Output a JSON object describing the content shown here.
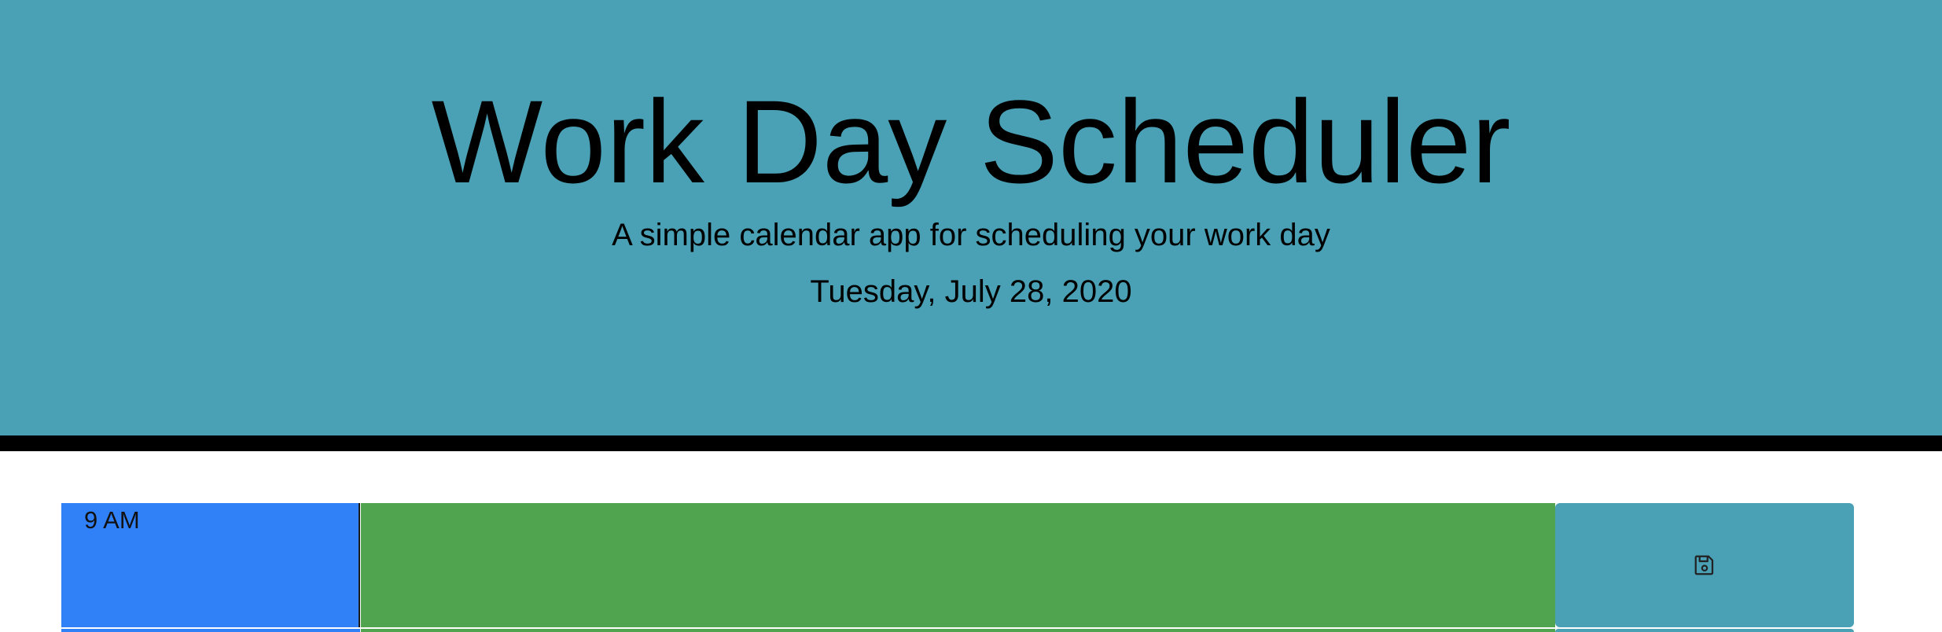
{
  "header": {
    "title": "Work Day Scheduler",
    "subtitle": "A simple calendar app for scheduling your work day",
    "current_day": "Tuesday, July 28, 2020"
  },
  "colors": {
    "header_bg": "#4aa1b5",
    "header_border": "#000000",
    "past": "#3080f8",
    "present": "#51a44f",
    "save_button": "#4aa1b5"
  },
  "time_blocks": [
    {
      "hour_label": "9 AM",
      "description": "",
      "state": "present",
      "save_icon": "floppy-disk-icon"
    }
  ]
}
